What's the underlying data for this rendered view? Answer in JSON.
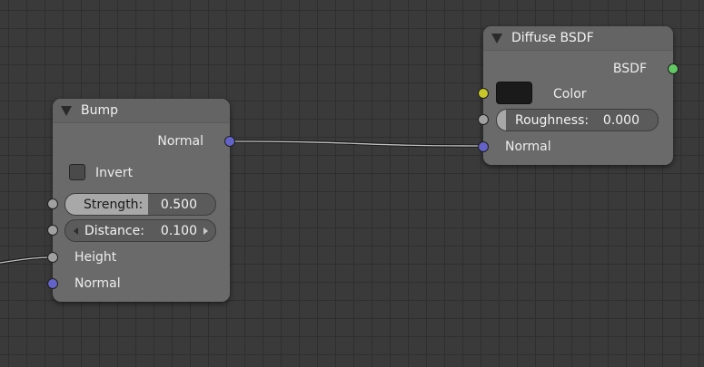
{
  "bump_node": {
    "title": "Bump",
    "output_normal": "Normal",
    "invert_label": "Invert",
    "strength": {
      "label": "Strength:",
      "value": "0.500"
    },
    "distance": {
      "label": "Distance:",
      "value": "0.100"
    },
    "height_label": "Height",
    "input_normal": "Normal"
  },
  "diffuse_node": {
    "title": "Diffuse BSDF",
    "output_bsdf": "BSDF",
    "color_label": "Color",
    "roughness": {
      "label": "Roughness:",
      "value": "0.000"
    },
    "input_normal": "Normal"
  },
  "colors": {
    "vector_socket": "#6363c7",
    "value_socket": "#a1a1a1",
    "color_socket": "#c7c729",
    "shader_socket": "#63c763",
    "color_value": "#1a1a1a"
  }
}
